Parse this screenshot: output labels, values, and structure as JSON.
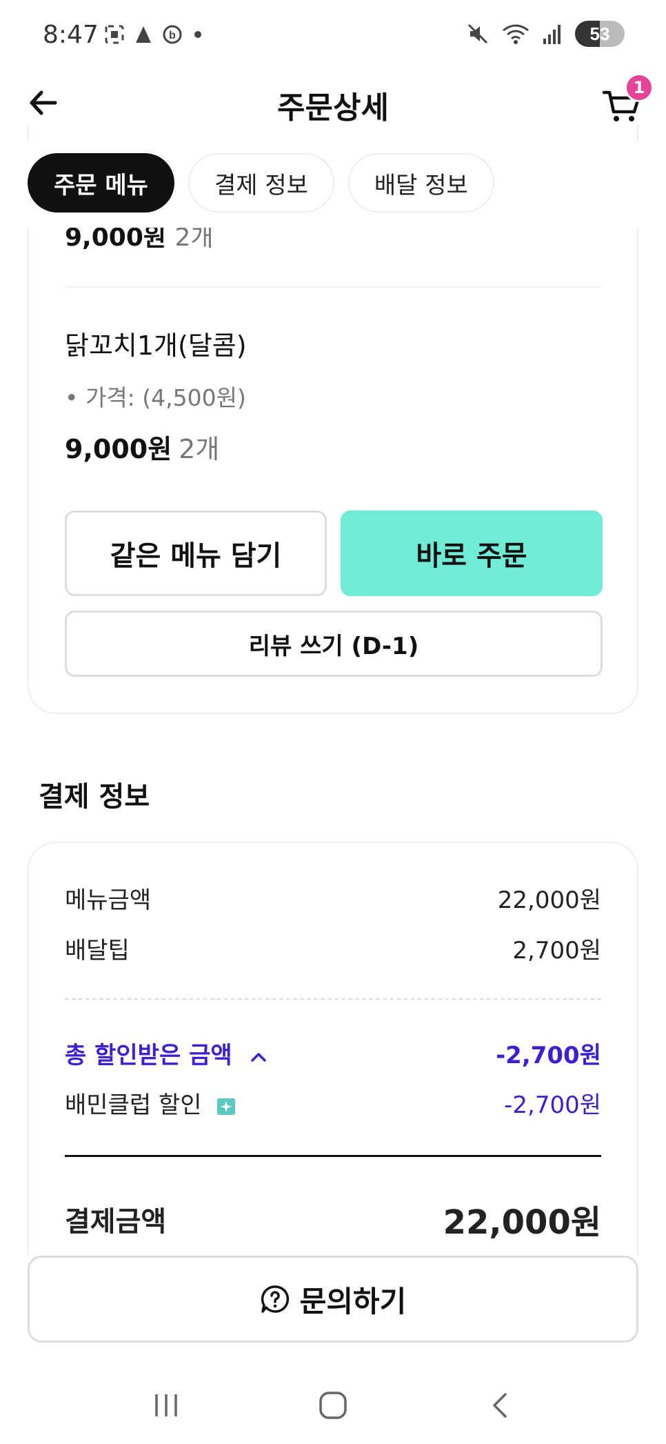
{
  "status_bar": {
    "time": "8:47",
    "battery": "53"
  },
  "header": {
    "title": "주문상세",
    "cart_badge": "1"
  },
  "tabs": [
    {
      "label": "주문 메뉴",
      "active": true
    },
    {
      "label": "결제 정보",
      "active": false
    },
    {
      "label": "배달 정보",
      "active": false
    }
  ],
  "menu": {
    "prev_item": {
      "price": "9,000원",
      "qty": "2개"
    },
    "item": {
      "name": "닭꼬치1개(달콤)",
      "option": "• 가격: (4,500원)",
      "price": "9,000원",
      "qty": "2개"
    },
    "buttons": {
      "add_same": "같은 메뉴 담기",
      "order_now": "바로 주문",
      "review": "리뷰 쓰기 (D-1)"
    }
  },
  "payment": {
    "heading": "결제 정보",
    "menu_amount_label": "메뉴금액",
    "menu_amount": "22,000원",
    "delivery_tip_label": "배달팁",
    "delivery_tip": "2,700원",
    "total_discount_label": "총 할인받은 금액",
    "total_discount": "-2,700원",
    "club_discount_label": "배민클럽 할인",
    "club_discount": "-2,700원",
    "total_label": "결제금액",
    "total": "22,000원"
  },
  "inquiry": {
    "label": "문의하기"
  },
  "colors": {
    "mint": "#70ebd6",
    "discount": "#3b1fd1",
    "badge": "#e6449a"
  }
}
